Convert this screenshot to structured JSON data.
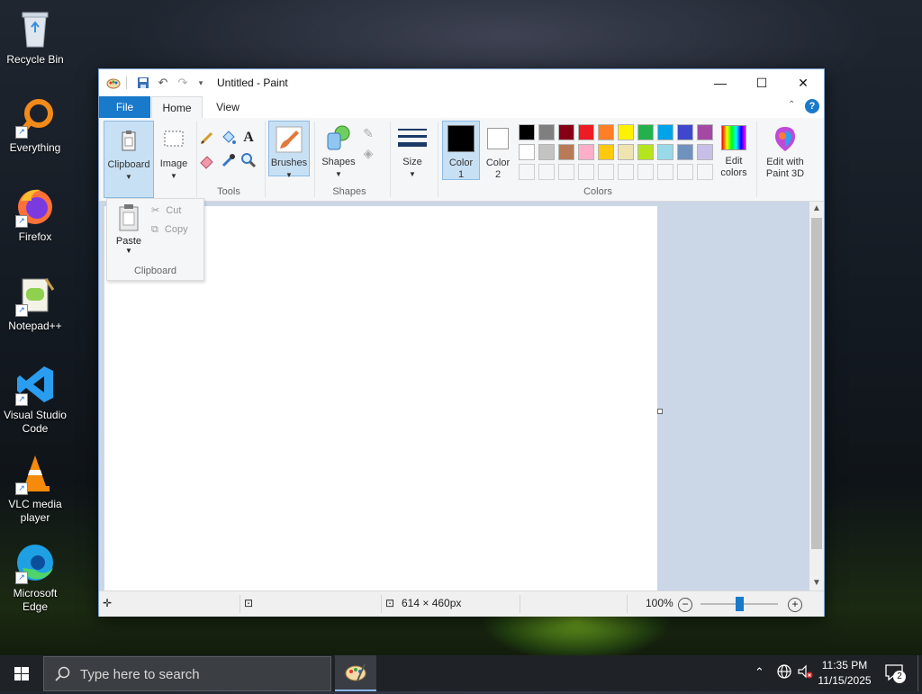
{
  "desktop": {
    "icons": [
      {
        "label_lines": [
          "Recycle Bin"
        ],
        "icon": "recycle-bin-icon"
      },
      {
        "label_lines": [
          "Everything"
        ],
        "icon": "everything-search-icon"
      },
      {
        "label_lines": [
          "Firefox"
        ],
        "icon": "firefox-icon"
      },
      {
        "label_lines": [
          "Notepad++"
        ],
        "icon": "notepad-plus-plus-icon"
      },
      {
        "label_lines": [
          "Visual Studio",
          "Code"
        ],
        "icon": "vscode-icon"
      },
      {
        "label_lines": [
          "VLC media",
          "player"
        ],
        "icon": "vlc-icon"
      },
      {
        "label_lines": [
          "Microsoft",
          "Edge"
        ],
        "icon": "edge-icon"
      }
    ]
  },
  "window": {
    "title": "Untitled - Paint",
    "tabs": {
      "file": "File",
      "home": "Home",
      "view": "View"
    },
    "clipboard_label": "Clipboard",
    "image_label": "Image",
    "tools_label": "Tools",
    "brushes_label": "Brushes",
    "shapes_label": "Shapes",
    "shapes_group_label": "Shapes",
    "size_label": "Size",
    "color1_label": "Color",
    "color1_num": "1",
    "color2_label": "Color",
    "color2_num": "2",
    "colors_group_label": "Colors",
    "edit_colors_line1": "Edit",
    "edit_colors_line2": "colors",
    "paint3d_line1": "Edit with",
    "paint3d_line2": "Paint 3D",
    "color1_value": "#000000",
    "color2_value": "#ffffff",
    "palette_row1": [
      "#000000",
      "#7f7f7f",
      "#880015",
      "#ed1c24",
      "#ff7f27",
      "#fff200",
      "#22b14c",
      "#00a2e8",
      "#3f48cc",
      "#a349a4"
    ],
    "palette_row2": [
      "#ffffff",
      "#c3c3c3",
      "#b97a57",
      "#ffaec9",
      "#ffc90e",
      "#efe4b0",
      "#b5e61d",
      "#99d9ea",
      "#7092be",
      "#c8bfe7"
    ],
    "palette_empty_slots": 10
  },
  "clipboard_dropdown": {
    "paste_label": "Paste",
    "cut_label": "Cut",
    "copy_label": "Copy",
    "group_label": "Clipboard"
  },
  "statusbar": {
    "canvas_size": "614 × 460px",
    "zoom": "100%",
    "zoom_level_fraction": 0.5
  },
  "taskbar": {
    "search_placeholder": "Type here to search",
    "time": "11:35 PM",
    "date": "11/15/2025",
    "notification_count": "2"
  }
}
